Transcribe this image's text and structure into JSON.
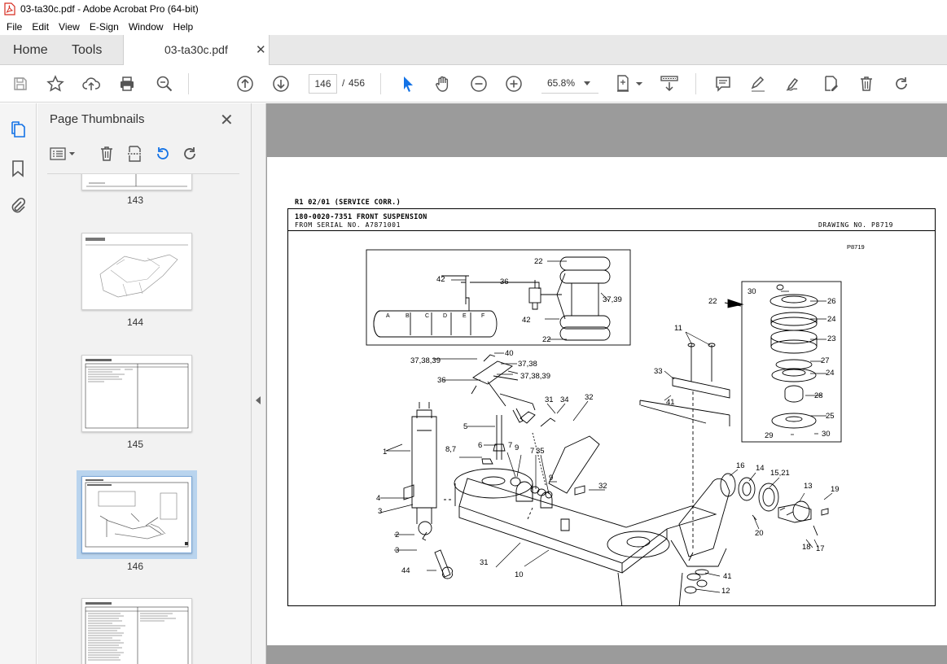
{
  "window": {
    "title": "03-ta30c.pdf - Adobe Acrobat Pro (64-bit)"
  },
  "menu": [
    "File",
    "Edit",
    "View",
    "E-Sign",
    "Window",
    "Help"
  ],
  "tabs": {
    "home": "Home",
    "tools": "Tools",
    "document": "03-ta30c.pdf"
  },
  "toolbar": {
    "current_page": "146",
    "total_pages": "456",
    "separator": "/",
    "zoom": "65.8%"
  },
  "thumbnail_panel": {
    "title": "Page Thumbnails",
    "pages": [
      "143",
      "144",
      "145",
      "146",
      ""
    ],
    "selected_page": "146"
  },
  "page": {
    "revision": "R1 02/01 (SERVICE CORR.)",
    "title": "180-0020-7351 FRONT SUSPENSION",
    "serial": "FROM SERIAL NO. A7871001",
    "drawing_no": "DRAWING NO. P8719",
    "drawing_code": "P8719",
    "callouts": {
      "c22a": "22",
      "c42a": "42",
      "c36a": "36",
      "c3739a": "37,39",
      "c42b": "42",
      "c22b": "22",
      "a": "A",
      "b": "B",
      "c": "C",
      "d": "D",
      "e": "E",
      "f": "F",
      "c30a": "30",
      "c26": "26",
      "c24a": "24",
      "c23": "23",
      "c27": "27",
      "c24b": "24",
      "c28": "28",
      "c25": "25",
      "c29": "29",
      "c30b": "30",
      "c22c": "22",
      "c40": "40",
      "c373839a": "37,38,39",
      "c3738": "37,38",
      "c36b": "36",
      "c373839b": "37,38,39",
      "c11": "11",
      "c33": "33",
      "c41a": "41",
      "c31a": "31",
      "c34": "34",
      "c32a": "32",
      "c5": "5",
      "c6": "6",
      "c87": "8,7",
      "c7a": "7",
      "c9a": "9",
      "c7b": "7",
      "c35": "35",
      "c9b": "9",
      "c32b": "32",
      "c1": "1",
      "c4": "4",
      "c3a": "3",
      "c2": "2",
      "c3b": "3",
      "c44": "44",
      "c31b": "31",
      "c10": "10",
      "c16": "16",
      "c14": "14",
      "c1521": "15,21",
      "c13": "13",
      "c19": "19",
      "c20": "20",
      "c18": "18",
      "c17": "17",
      "c41b": "41",
      "c12": "12"
    }
  },
  "colors": {
    "accent": "#1473e6",
    "page_bg": "#9b9b9b",
    "panel_bg": "#f2f2f2"
  }
}
